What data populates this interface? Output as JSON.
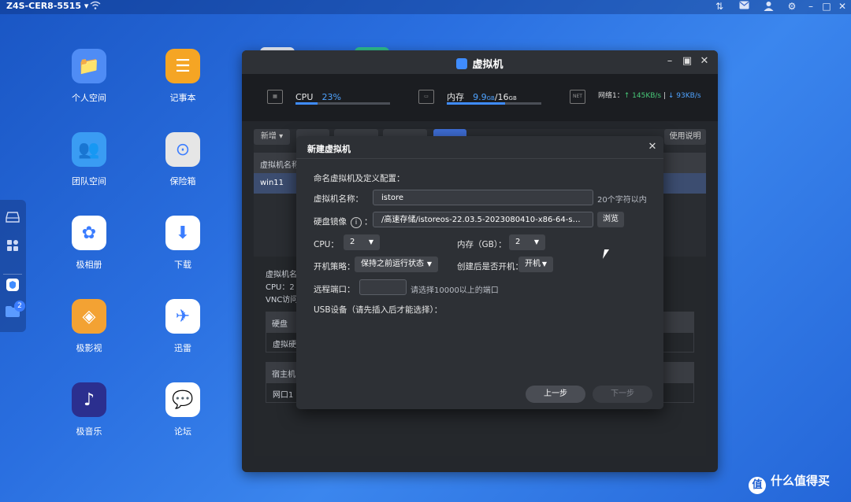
{
  "topbar": {
    "device": "Z4S-CER8-5515",
    "icons": [
      "wifi-icon",
      "transfer-icon",
      "mail-icon",
      "user-icon",
      "gear-icon",
      "minimize-icon",
      "maximize-icon",
      "close-icon"
    ]
  },
  "desktop": {
    "icons": [
      {
        "label": "个人空间",
        "icon": "folder-icon",
        "color": "#4f8cf5"
      },
      {
        "label": "记事本",
        "icon": "notepad-icon",
        "color": "#f5a524"
      },
      {
        "label": "团队空间",
        "icon": "team-folder-icon",
        "color": "#3a9cf3"
      },
      {
        "label": "保险箱",
        "icon": "safe-icon",
        "color": "#e6e6e6"
      },
      {
        "label": "极相册",
        "icon": "photos-icon",
        "color": "#ffffff"
      },
      {
        "label": "下载",
        "icon": "download-icon",
        "color": "#ffffff"
      },
      {
        "label": "极影视",
        "icon": "video-icon",
        "color": "#f3a233"
      },
      {
        "label": "迅雷",
        "icon": "thunder-icon",
        "color": "#ffffff"
      },
      {
        "label": "极音乐",
        "icon": "music-icon",
        "color": "#2b2f8f"
      },
      {
        "label": "论坛",
        "icon": "forum-icon",
        "color": "#ffffff"
      }
    ]
  },
  "dock": {
    "badge": "2"
  },
  "vm_window": {
    "title": "虚拟机",
    "stats": {
      "cpu_label": "CPU",
      "cpu_value": "23%",
      "cpu_fraction": 0.23,
      "mem_label": "内存",
      "mem_value": "9.9",
      "mem_unit": "GB",
      "mem_sep": "/16",
      "mem_total_unit": "GB",
      "mem_fraction": 0.62,
      "net_label": "网络1：",
      "net_up": "↑ 145KB/s",
      "net_sep": " | ",
      "net_down": "↓ 93KB/s",
      "chip_text": "NET"
    },
    "toolbar": {
      "new_label": "新增 ▾",
      "help_label": "使用说明"
    },
    "list": {
      "header": "虚拟机名称",
      "row": "win11"
    },
    "detail": {
      "name_label": "虚拟机名",
      "cpu_label": "CPU：2",
      "vnc_label": "VNC访问",
      "disk_header": "硬盘",
      "disk_row": "虚拟硬盘",
      "host_header": "宿主机",
      "net_row": "网口1"
    }
  },
  "modal": {
    "title": "新建虚拟机",
    "section": "命名虚拟机及定义配置：",
    "name_label": "虚拟机名称：",
    "name_value": "istore",
    "name_hint": "20个字符以内",
    "image_label": "硬盘镜像",
    "image_colon": "：",
    "image_value": "/高速存储/istoreos-22.03.5-2023080410-x86-64-squa...",
    "browse_label": "浏览",
    "cpu_label": "CPU：",
    "cpu_value": "2",
    "mem_label": "内存（GB）：",
    "mem_value": "2",
    "boot_label": "开机策略：",
    "boot_value": "保持之前运行状态",
    "autostart_label": "创建后是否开机：",
    "autostart_value": "开机",
    "port_label": "远程端口：",
    "port_value": "",
    "port_hint": "请选择10000以上的端口",
    "usb_label": "USB设备（请先插入后才能选择）：",
    "prev_label": "上一步",
    "next_label": "下一步"
  },
  "brand": {
    "text": "什么值得买",
    "mark": "值"
  }
}
